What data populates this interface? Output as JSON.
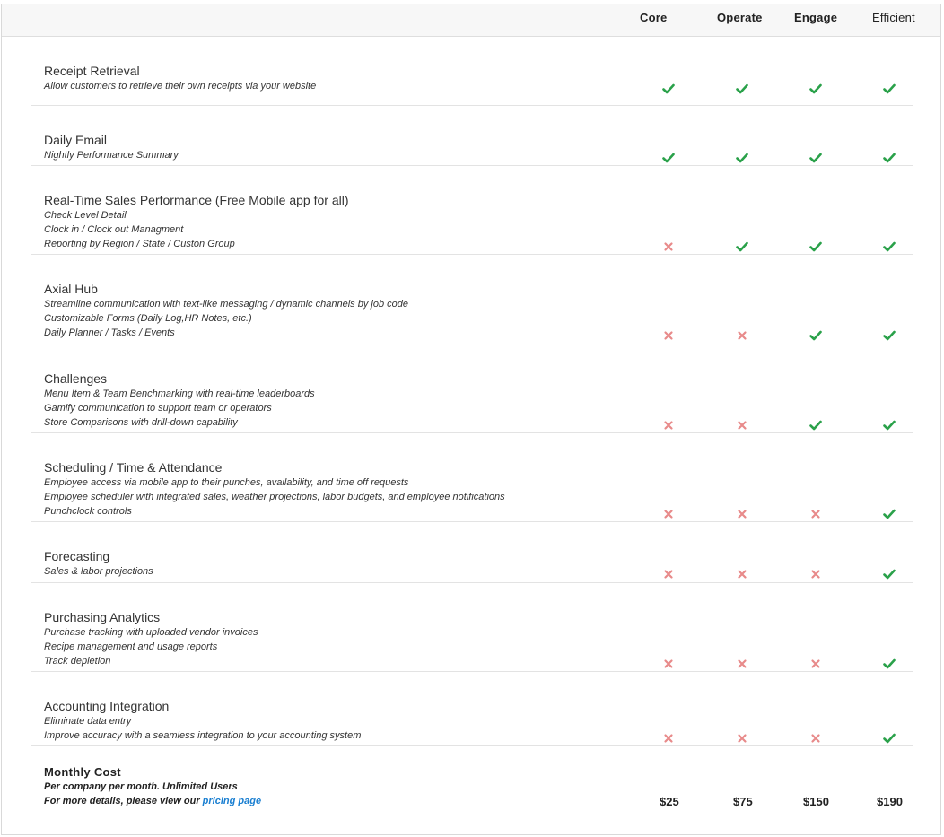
{
  "columns": [
    "Core",
    "Operate",
    "Engage",
    "Efficient"
  ],
  "colors": {
    "check": "#2aa14a",
    "cross": "#e88a8a"
  },
  "icons": {
    "included": "check-icon",
    "excluded": "cross-icon"
  },
  "features": [
    {
      "title": "Receipt Retrieval",
      "lines": [
        "Allow customers to retrieve their own receipts via your website"
      ],
      "availability": [
        true,
        true,
        true,
        true
      ]
    },
    {
      "title": "Daily Email",
      "lines": [
        "Nightly Performance Summary"
      ],
      "availability": [
        true,
        true,
        true,
        true
      ]
    },
    {
      "title": "Real-Time Sales Performance (Free Mobile app for all)",
      "lines": [
        "Check Level Detail",
        "Clock in / Clock out Managment",
        "Reporting by Region / State / Custon Group"
      ],
      "availability": [
        false,
        true,
        true,
        true
      ]
    },
    {
      "title": "Axial Hub",
      "lines": [
        "Streamline communication with text-like messaging / dynamic channels by job code",
        "Customizable Forms (Daily Log,HR Notes, etc.)",
        "Daily Planner / Tasks / Events"
      ],
      "availability": [
        false,
        false,
        true,
        true
      ]
    },
    {
      "title": "Challenges",
      "lines": [
        "Menu Item & Team Benchmarking with real-time leaderboards",
        "Gamify communication to support team or operators",
        "Store Comparisons with drill-down capability"
      ],
      "availability": [
        false,
        false,
        true,
        true
      ]
    },
    {
      "title": "Scheduling / Time & Attendance",
      "lines": [
        "Employee access via mobile app to their punches, availability, and time off requests",
        "Employee scheduler with integrated sales, weather projections, labor budgets, and employee notifications",
        "Punchclock controls"
      ],
      "availability": [
        false,
        false,
        false,
        true
      ]
    },
    {
      "title": "Forecasting",
      "lines": [
        "Sales & labor projections"
      ],
      "availability": [
        false,
        false,
        false,
        true
      ]
    },
    {
      "title": "Purchasing Analytics",
      "lines": [
        "Purchase tracking with uploaded vendor invoices",
        "Recipe management and usage reports",
        "Track depletion"
      ],
      "availability": [
        false,
        false,
        false,
        true
      ]
    },
    {
      "title": "Accounting Integration",
      "lines": [
        "Eliminate data entry",
        "Improve accuracy with a seamless integration to your accounting system"
      ],
      "availability": [
        false,
        false,
        false,
        true
      ]
    }
  ],
  "cost": {
    "title": "Monthly Cost",
    "line1": "Per company per month. Unlimited Users",
    "line2_prefix": "For more details, please view our ",
    "link_label": "pricing page",
    "prices": [
      "$25",
      "$75",
      "$150",
      "$190"
    ]
  }
}
